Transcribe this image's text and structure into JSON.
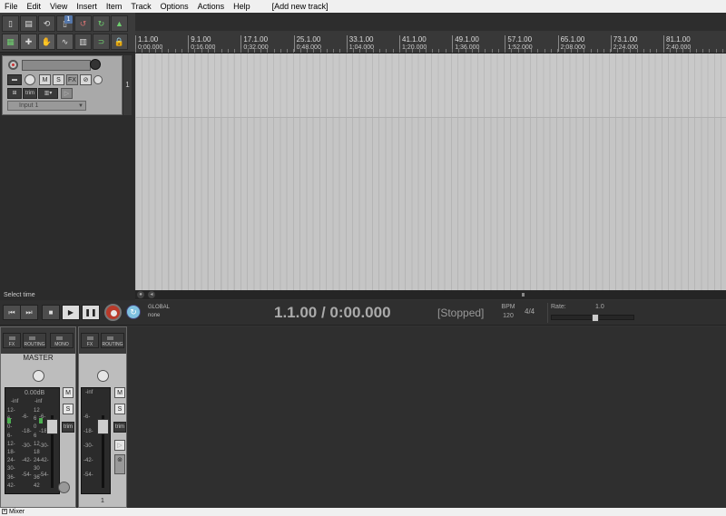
{
  "menu": [
    "File",
    "Edit",
    "View",
    "Insert",
    "Item",
    "Track",
    "Options",
    "Actions",
    "Help"
  ],
  "menu_extra": "[Add new track]",
  "toolbar": {
    "badge": "1"
  },
  "track": {
    "number": "1",
    "mute_label": "M",
    "solo_label": "S",
    "fx_label": "FX",
    "input_label": "Input 1",
    "trim_label": "trim"
  },
  "ruler": {
    "marks": [
      {
        "bar": "1.1.00",
        "time": "0:00.000"
      },
      {
        "bar": "9.1.00",
        "time": "0:16.000"
      },
      {
        "bar": "17.1.00",
        "time": "0:32.000"
      },
      {
        "bar": "25.1.00",
        "time": "0:48.000"
      },
      {
        "bar": "33.1.00",
        "time": "1:04.000"
      },
      {
        "bar": "41.1.00",
        "time": "1:20.000"
      },
      {
        "bar": "49.1.00",
        "time": "1:36.000"
      },
      {
        "bar": "57.1.00",
        "time": "1:52.000"
      },
      {
        "bar": "65.1.00",
        "time": "2:08.000"
      },
      {
        "bar": "73.1.00",
        "time": "2:24.000"
      },
      {
        "bar": "81.1.00",
        "time": "2:40.000"
      }
    ]
  },
  "status": {
    "select_time": "Select time"
  },
  "transport": {
    "global_label": "GLOBAL",
    "global_value": "none",
    "time": "1.1.00 / 0:00.000",
    "state": "[Stopped]",
    "bpm_label": "BPM",
    "bpm": "120",
    "signature": "4/4",
    "rate_label": "Rate:",
    "rate_value": "1.0"
  },
  "mixer": {
    "master_name": "MASTER",
    "fx_label": "FX",
    "routing_label": "ROUTING",
    "mono_label": "MONO",
    "db_readout": "0.00dB",
    "inf": "-inf",
    "scale_left": [
      "12-",
      "6-",
      "0-",
      "6-",
      "12-",
      "18-",
      "24-",
      "30-",
      "36-",
      "42-"
    ],
    "scale_mid": [
      "-6-",
      "-18-",
      "-30-",
      "-42-",
      "-54-"
    ],
    "scale_right": [
      "12",
      "6",
      "0",
      "6",
      "12",
      "18",
      "24",
      "30",
      "36",
      "42"
    ],
    "scale_right2": [
      "-6-",
      "-18-",
      "-30-",
      "-42-",
      "-54-"
    ],
    "mute_label": "M",
    "solo_label": "S",
    "trim_label": "trim",
    "track_fader_scale": [
      "-6-",
      "-18-",
      "-30-",
      "-42-",
      "-54-"
    ],
    "track_number": "1",
    "tab_label": "Mixer"
  }
}
